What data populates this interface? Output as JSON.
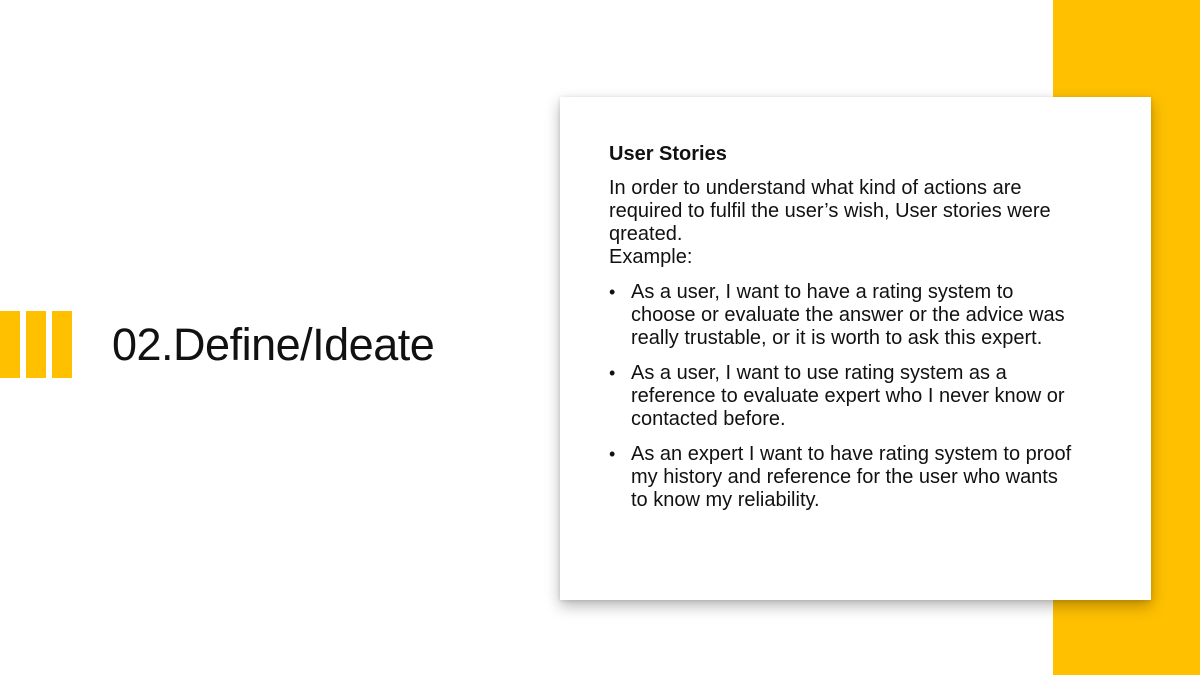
{
  "colors": {
    "accent": "#FFC000",
    "text": "#111111",
    "background": "#FFFFFF"
  },
  "slide": {
    "title": "02.Define/Ideate"
  },
  "card": {
    "heading": "User Stories",
    "intro_lines": [
      "In order to understand what kind of actions are",
      "required to fulfil the user’s wish, User stories were",
      "qreated.",
      "Example:"
    ],
    "bullet_symbol": "•",
    "stories": [
      {
        "lines": [
          "As a user, I want to have a rating system to",
          "choose or evaluate the answer or the advice was",
          "really trustable, or it is worth to ask this expert."
        ]
      },
      {
        "lines": [
          "As a user, I want to use rating system as a",
          "reference to evaluate expert who I never know or",
          "contacted before."
        ]
      },
      {
        "lines": [
          "As an expert I want to have rating system to proof",
          "my history and reference for the user who wants",
          "to know my reliability."
        ]
      }
    ]
  }
}
